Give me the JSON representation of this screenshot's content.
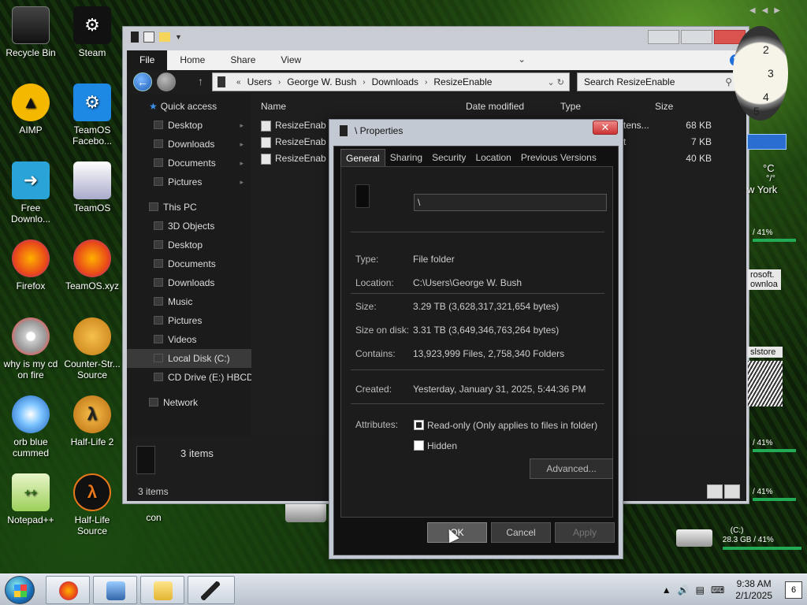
{
  "desktop": {
    "icons": [
      {
        "label": "Recycle Bin",
        "icon": "recycle-bin-icon"
      },
      {
        "label": "Steam",
        "icon": "steam-icon"
      },
      {
        "label": "AIMP",
        "icon": "aimp-icon"
      },
      {
        "label": "TeamOS Facebo...",
        "icon": "teamos-gear-icon"
      },
      {
        "label": "Free Downlo...",
        "icon": "free-download-icon"
      },
      {
        "label": "TeamOS",
        "icon": "teamos-folder-icon"
      },
      {
        "label": "Firefox",
        "icon": "firefox-icon"
      },
      {
        "label": "TeamOS.xyz",
        "icon": "firefox-icon"
      },
      {
        "label": "why is my cd on fire",
        "icon": "burning-cd-icon"
      },
      {
        "label": "Counter-Str... Source",
        "icon": "counter-strike-icon"
      },
      {
        "label": "orb blue cummed",
        "icon": "blue-orb-icon"
      },
      {
        "label": "Half-Life 2",
        "icon": "half-life-2-icon"
      },
      {
        "label": "Notepad++",
        "icon": "notepad-plus-plus-icon"
      },
      {
        "label": "Half-Life Source",
        "icon": "half-life-icon"
      },
      {
        "label": "con",
        "icon": "drive-icon"
      }
    ]
  },
  "explorer": {
    "ribbon_tabs": [
      "File",
      "Home",
      "Share",
      "View"
    ],
    "help": "?",
    "address": {
      "crumbs": [
        "Users",
        "George W. Bush",
        "Downloads",
        "ResizeEnable"
      ]
    },
    "search_placeholder": "Search ResizeEnable",
    "sidebar": [
      {
        "label": "Quick access",
        "level": 1,
        "icon": "star-icon"
      },
      {
        "label": "Desktop",
        "level": 2,
        "pinned": true
      },
      {
        "label": "Downloads",
        "level": 2,
        "pinned": true
      },
      {
        "label": "Documents",
        "level": 2,
        "pinned": true
      },
      {
        "label": "Pictures",
        "level": 2,
        "pinned": true
      },
      {
        "label": "This PC",
        "level": 1
      },
      {
        "label": "3D Objects",
        "level": 2
      },
      {
        "label": "Desktop",
        "level": 2
      },
      {
        "label": "Documents",
        "level": 2
      },
      {
        "label": "Downloads",
        "level": 2
      },
      {
        "label": "Music",
        "level": 2
      },
      {
        "label": "Pictures",
        "level": 2
      },
      {
        "label": "Videos",
        "level": 2
      },
      {
        "label": "Local Disk (C:)",
        "level": 2,
        "selected": true
      },
      {
        "label": "CD Drive (E:) HBCD_",
        "level": 2
      },
      {
        "label": "Network",
        "level": 1
      }
    ],
    "columns": {
      "name": "Name",
      "date": "Date modified",
      "type": "Type",
      "size": "Size"
    },
    "files": [
      {
        "name": "ResizeEnab",
        "type": "tens...",
        "size": "68 KB"
      },
      {
        "name": "ResizeEnab",
        "type": "t",
        "size": "7 KB"
      },
      {
        "name": "ResizeEnab",
        "type": "",
        "size": "40 KB"
      }
    ],
    "detail_count": "3 items",
    "status": "3 items"
  },
  "properties": {
    "title": "\\ Properties",
    "tabs": [
      "General",
      "Sharing",
      "Security",
      "Location",
      "Previous Versions"
    ],
    "active_tab": "General",
    "name_value": "\\",
    "rows": {
      "type": {
        "label": "Type:",
        "value": "File folder"
      },
      "location": {
        "label": "Location:",
        "value": "C:\\Users\\George W. Bush"
      },
      "size": {
        "label": "Size:",
        "value": "3.29 TB (3,628,317,321,654 bytes)"
      },
      "size_on_disk": {
        "label": "Size on disk:",
        "value": "3.31 TB (3,649,346,763,264 bytes)"
      },
      "contains": {
        "label": "Contains:",
        "value": "13,923,999 Files, 2,758,340 Folders"
      },
      "created": {
        "label": "Created:",
        "value": "Yesterday, January 31, 2025, 5:44:36 PM"
      }
    },
    "attributes_label": "Attributes:",
    "readonly_label": "Read-only (Only applies to files in folder)",
    "hidden_label": "Hidden",
    "advanced_label": "Advanced...",
    "buttons": {
      "ok": "OK",
      "cancel": "Cancel",
      "apply": "Apply"
    }
  },
  "gadgets": {
    "weather_temp": "°C",
    "weather_sub": "°/°",
    "weather_city": "w York",
    "meters": [
      "/ 41%",
      "/ 41%",
      "/ 41%",
      "/ 41%"
    ],
    "snips": [
      "rosoft.",
      "ownloa",
      "slstore"
    ],
    "drive_label": "(C:)",
    "drive_usage": "28.3 GB / 41%"
  },
  "taskbar": {
    "clock_time": "9:38 AM",
    "clock_date": "2/1/2025",
    "notification_count": "6",
    "colors": {
      "start_orb": "#1a6fb8"
    }
  }
}
